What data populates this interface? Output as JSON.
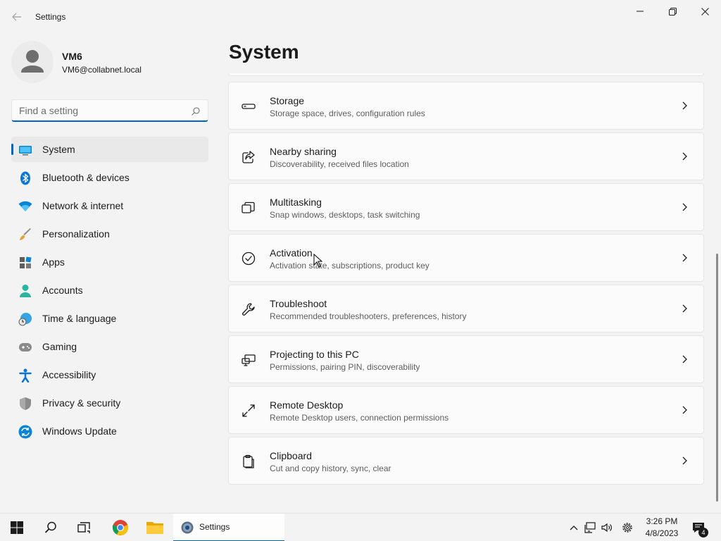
{
  "window": {
    "title": "Settings",
    "back_icon": "back-arrow-icon",
    "controls": [
      "minimize",
      "maximize",
      "close"
    ]
  },
  "profile": {
    "name": "VM6",
    "email": "VM6@collabnet.local"
  },
  "search": {
    "placeholder": "Find a setting",
    "value": ""
  },
  "sidebar": {
    "items": [
      {
        "label": "System",
        "icon": "monitor-icon",
        "active": true
      },
      {
        "label": "Bluetooth & devices",
        "icon": "bluetooth-icon"
      },
      {
        "label": "Network & internet",
        "icon": "wifi-icon"
      },
      {
        "label": "Personalization",
        "icon": "paintbrush-icon"
      },
      {
        "label": "Apps",
        "icon": "apps-grid-icon"
      },
      {
        "label": "Accounts",
        "icon": "person-icon"
      },
      {
        "label": "Time & language",
        "icon": "globe-clock-icon"
      },
      {
        "label": "Gaming",
        "icon": "gamepad-icon"
      },
      {
        "label": "Accessibility",
        "icon": "accessibility-icon"
      },
      {
        "label": "Privacy & security",
        "icon": "shield-icon"
      },
      {
        "label": "Windows Update",
        "icon": "update-icon"
      }
    ]
  },
  "main": {
    "title": "System",
    "cards": [
      {
        "title": "Storage",
        "desc": "Storage space, drives, configuration rules",
        "icon": "storage-drive-icon"
      },
      {
        "title": "Nearby sharing",
        "desc": "Discoverability, received files location",
        "icon": "share-icon"
      },
      {
        "title": "Multitasking",
        "desc": "Snap windows, desktops, task switching",
        "icon": "multitasking-icon"
      },
      {
        "title": "Activation",
        "desc": "Activation state, subscriptions, product key",
        "icon": "checkmark-circle-icon"
      },
      {
        "title": "Troubleshoot",
        "desc": "Recommended troubleshooters, preferences, history",
        "icon": "wrench-icon"
      },
      {
        "title": "Projecting to this PC",
        "desc": "Permissions, pairing PIN, discoverability",
        "icon": "projecting-icon"
      },
      {
        "title": "Remote Desktop",
        "desc": "Remote Desktop users, connection permissions",
        "icon": "remote-desktop-icon"
      },
      {
        "title": "Clipboard",
        "desc": "Cut and copy history, sync, clear",
        "icon": "clipboard-icon"
      }
    ]
  },
  "taskbar": {
    "active_app_label": "Settings",
    "pinned": [
      "start-icon",
      "search-icon",
      "task-view-icon",
      "chrome-icon",
      "file-explorer-icon",
      "settings-icon"
    ],
    "tray": {
      "time": "3:26 PM",
      "date": "4/8/2023",
      "notification_count": "4"
    }
  },
  "colors": {
    "accent": "#0067c0",
    "background": "#f3f3f3",
    "card": "#fbfbfb"
  }
}
